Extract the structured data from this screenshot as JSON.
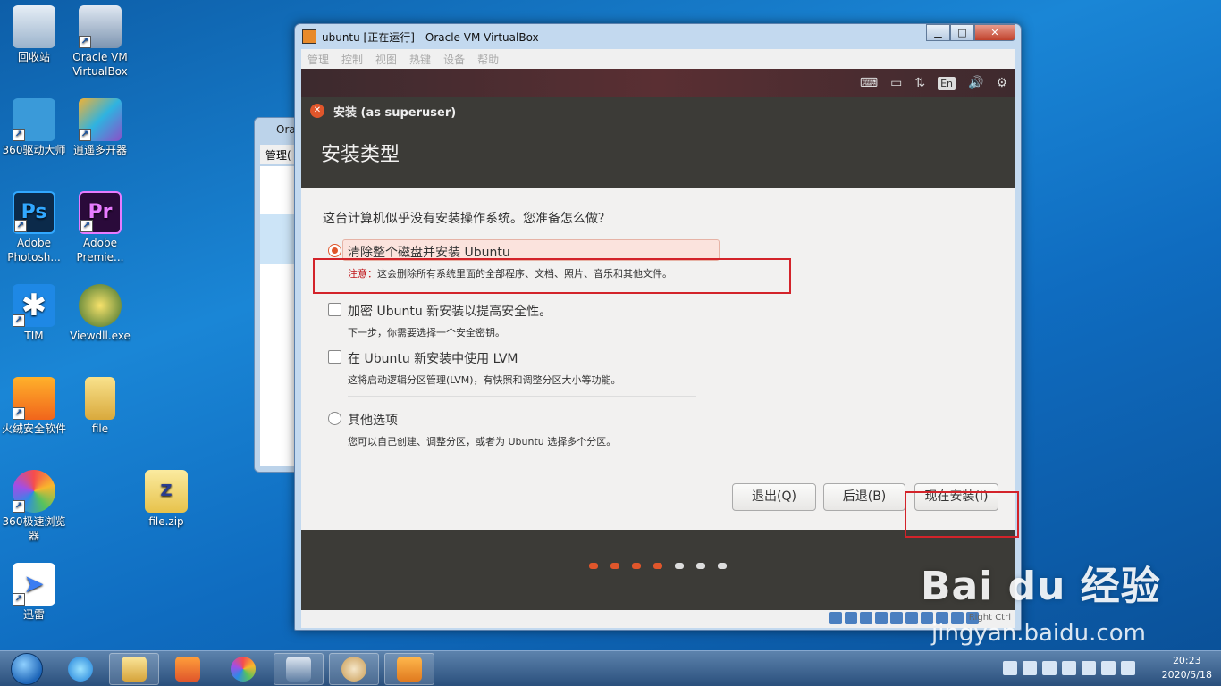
{
  "desktop": {
    "icons": [
      {
        "label": "回收站"
      },
      {
        "label": "Oracle VM VirtualBox"
      },
      {
        "label": "360驱动大师"
      },
      {
        "label": "逍遥多开器"
      },
      {
        "label": "Adobe Photosh..."
      },
      {
        "label": "Adobe Premie..."
      },
      {
        "label": "TIM"
      },
      {
        "label": "Viewdll.exe"
      },
      {
        "label": "火绒安全软件"
      },
      {
        "label": "file"
      },
      {
        "label": "360极速浏览器"
      },
      {
        "label": "file.zip"
      },
      {
        "label": "迅雷"
      }
    ]
  },
  "bg_window": {
    "title": "Ora",
    "menu": "管理("
  },
  "vm_window": {
    "title": "ubuntu [正在运行] - Oracle VM VirtualBox",
    "controls": {
      "minimize": "▁",
      "maximize": "□",
      "close": "✕"
    },
    "menu": [
      "管理",
      "控制",
      "视图",
      "热键",
      "设备",
      "帮助"
    ],
    "status_host_key": "Right Ctrl"
  },
  "guest_topbar": {
    "lang": "En"
  },
  "installer": {
    "window_title": "安装 (as superuser)",
    "heading": "安装类型",
    "question": "这台计算机似乎没有安装操作系统。您准备怎么做？",
    "options": [
      {
        "label": "清除整个磁盘并安装 Ubuntu",
        "note_label": "注意：",
        "note": "这会删除所有系统里面的全部程序、文档、照片、音乐和其他文件。"
      },
      {
        "label": "加密 Ubuntu 新安装以提高安全性。",
        "note": "下一步，你需要选择一个安全密钥。"
      },
      {
        "label": "在 Ubuntu 新安装中使用 LVM",
        "note": "这将启动逻辑分区管理(LVM)，有快照和调整分区大小等功能。"
      },
      {
        "label": "其他选项",
        "note": "您可以自己创建、调整分区，或者为 Ubuntu 选择多个分区。"
      }
    ],
    "buttons": {
      "quit": "退出(Q)",
      "back": "后退(B)",
      "install": "现在安装(I)"
    },
    "progress": {
      "total_steps": 7,
      "completed_steps": 4
    }
  },
  "watermark": {
    "brand": "Bai du 经验",
    "url": "jingyan.baidu.com"
  },
  "clock": {
    "time": "20:23",
    "date": "2020/5/18"
  },
  "colors": {
    "accent": "#e0562b",
    "highlight_box": "#d3232a"
  }
}
